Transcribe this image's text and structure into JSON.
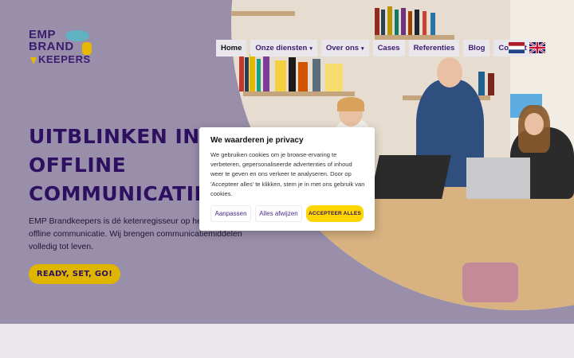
{
  "logo": {
    "line1": "EMP",
    "line2": "BRAND",
    "line3": "KEEPERS"
  },
  "nav": {
    "items": [
      {
        "label": "Home",
        "dropdown": false,
        "active": true
      },
      {
        "label": "Onze diensten",
        "dropdown": true,
        "active": false
      },
      {
        "label": "Over ons",
        "dropdown": true,
        "active": false
      },
      {
        "label": "Cases",
        "dropdown": false,
        "active": false
      },
      {
        "label": "Referenties",
        "dropdown": false,
        "active": false
      },
      {
        "label": "Blog",
        "dropdown": false,
        "active": false
      },
      {
        "label": "Contact",
        "dropdown": false,
        "active": false
      }
    ],
    "caret": "▾",
    "flags": [
      "dutch-flag-icon",
      "uk-flag-icon"
    ]
  },
  "hero": {
    "title_lines": [
      "UITBLINKEN IN",
      "OFFLINE",
      "COMMUNICATIE"
    ],
    "lead_lines": [
      "EMP Brandkeepers is dé ketenregisseur op het gebied van",
      "offline communicatie. Wij brengen communicatiemiddelen",
      "volledig tot leven."
    ],
    "cta_label": "READY, SET, GO!"
  },
  "cookie": {
    "title": "We waarderen je privacy",
    "body_lines": [
      "We gebruiken cookies om je browse-ervaring te",
      "verbeteren, gepersonaliseerde advertenties of inhoud",
      "weer te geven en ons verkeer te analyseren. Door op",
      "'Accepteer alles' te klikken, stem je in met ons gebruik van",
      "cookies."
    ],
    "btn_customize": "Aanpassen",
    "btn_reject": "Alles afwijzen",
    "btn_accept": "ACCEPTEER ALLES"
  },
  "colors": {
    "hero_bg": "#9a8fab",
    "brand_purple": "#2e1060",
    "accent_yellow": "#e0b500",
    "nav_bg": "#e9e7ec"
  }
}
